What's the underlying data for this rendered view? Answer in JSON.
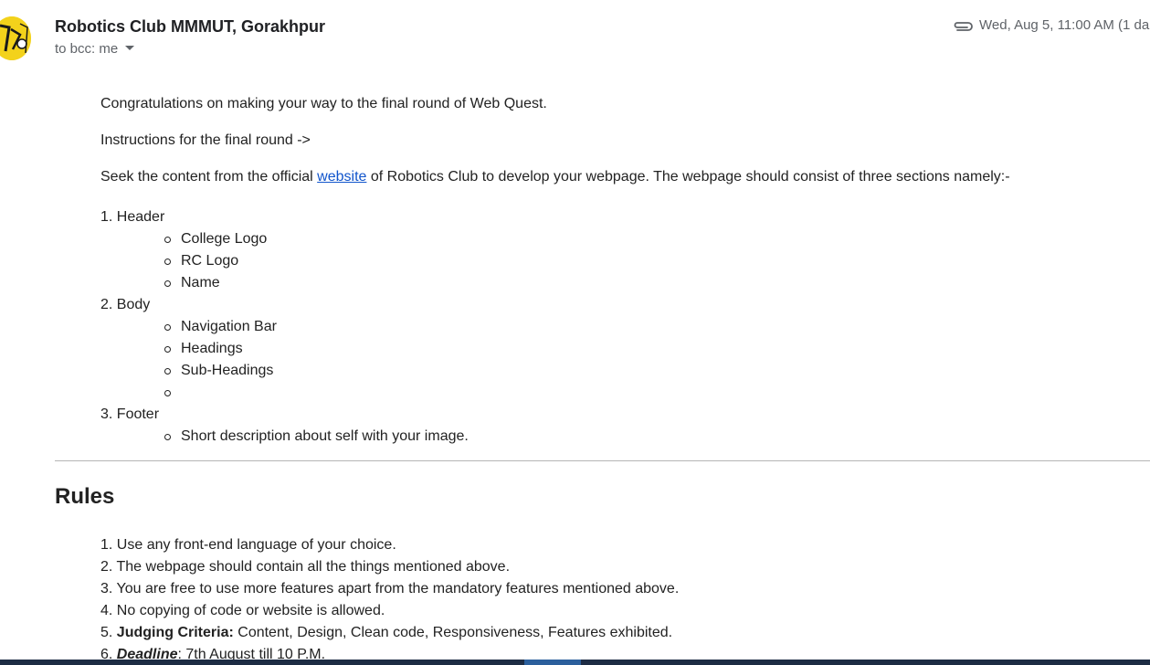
{
  "header": {
    "sender": "Robotics Club MMMUT, Gorakhpur",
    "recipients": "to bcc: me",
    "date": "Wed, Aug 5, 11:00 AM (1 da"
  },
  "body": {
    "congrats": "Congratulations on making your way to the final round of Web Quest.",
    "instructions": "Instructions for the final round ->",
    "seek_before": "Seek the content from the official ",
    "seek_link": "website",
    "seek_after": " of Robotics Club to develop your webpage. The webpage should consist of three sections namely:-"
  },
  "sections": [
    {
      "label": "1. Header",
      "items": [
        "College Logo",
        "RC Logo",
        "Name"
      ]
    },
    {
      "label": "2. Body",
      "items": [
        "Navigation Bar",
        "Headings",
        "Sub-Headings",
        ""
      ]
    },
    {
      "label": "3. Footer",
      "items": [
        "Short description about self with your image."
      ]
    }
  ],
  "rules": {
    "title": "Rules",
    "items": [
      "1. Use any front-end language of your choice.",
      "2. The webpage should contain all the things mentioned above.",
      "3. You are free to use more features apart from the mandatory features mentioned above.",
      "4. No copying of code or website is allowed."
    ],
    "judging_prefix": "5. ",
    "judging_label": "Judging Criteria:",
    "judging_text": " Content, Design, Clean code, Responsiveness, Features exhibited.",
    "deadline_prefix": "6. ",
    "deadline_label": "Deadline",
    "deadline_text": ": 7th August till 10 P.M."
  },
  "icons": {
    "attachment": "paperclip-icon",
    "recipient_toggle": "chevron-down-icon"
  },
  "colors": {
    "link": "#1155cc",
    "avatar": "#f3d21b",
    "taskbar": "#1d2c44"
  }
}
